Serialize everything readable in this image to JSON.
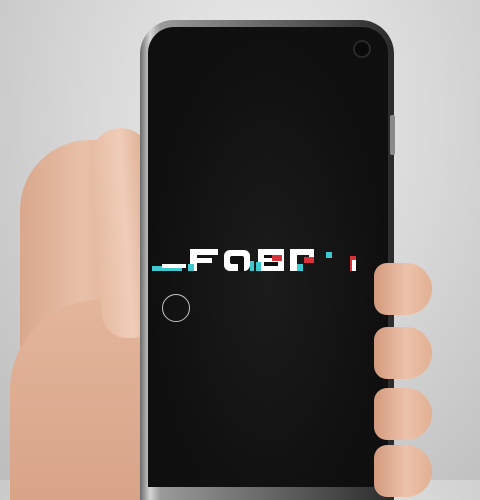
{
  "logo": {
    "text": "_FABR",
    "colors": {
      "white": "#ffffff",
      "cyan": "#3ec8cf",
      "red": "#d8333a"
    }
  },
  "touch_indicator": {
    "shape": "circle"
  },
  "icons": [
    "camera-icon",
    "touch-circle-icon"
  ]
}
